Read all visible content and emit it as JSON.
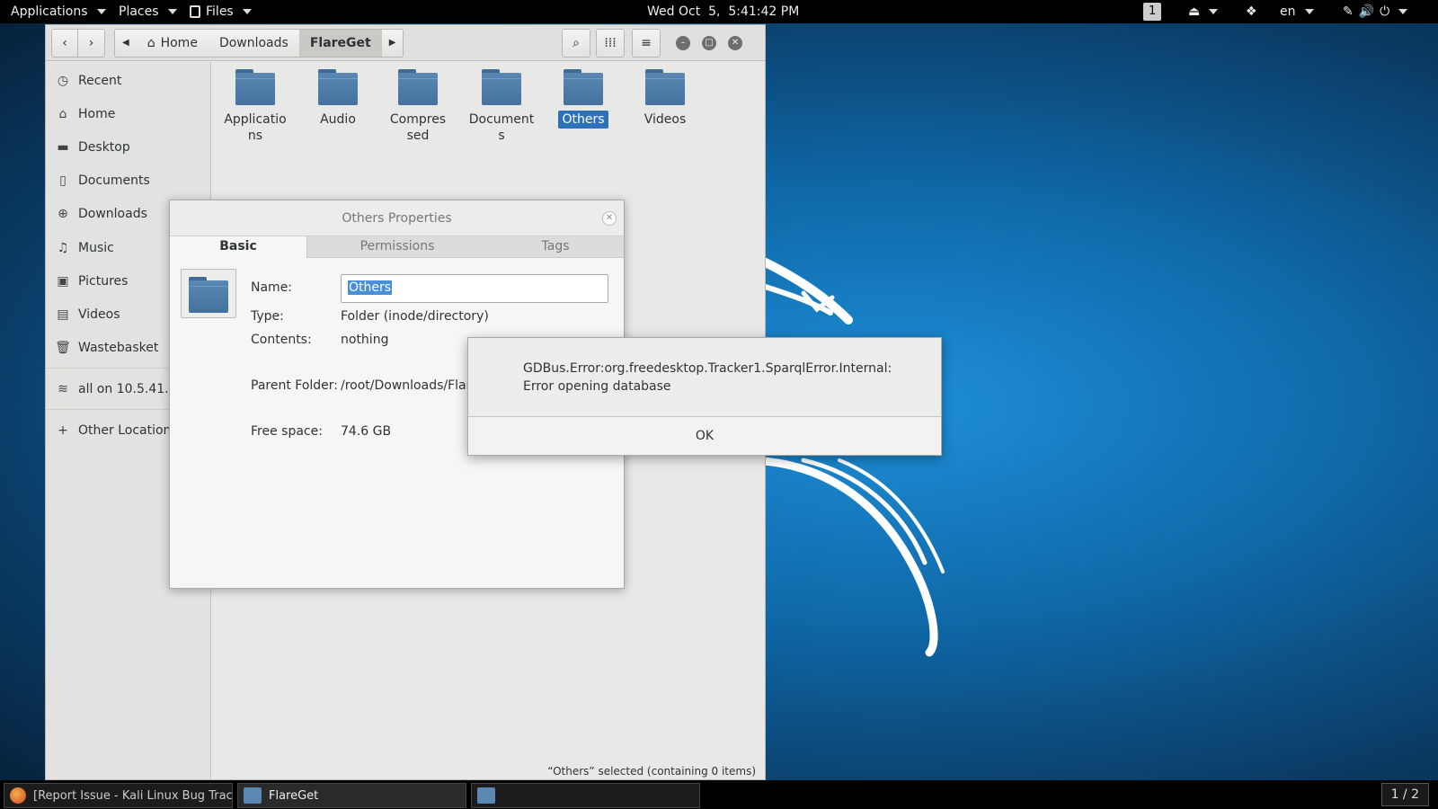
{
  "topbar": {
    "applications": "Applications",
    "places": "Places",
    "files": "Files",
    "clock": "Wed Oct  5,  5:41:42 PM",
    "workspace": "1",
    "language": "en"
  },
  "file_manager": {
    "breadcrumbs": [
      "Home",
      "Downloads",
      "FlareGet"
    ],
    "active_crumb": "FlareGet",
    "sidebar": {
      "items": [
        "Recent",
        "Home",
        "Desktop",
        "Documents",
        "Downloads",
        "Music",
        "Pictures",
        "Videos",
        "Wastebasket"
      ],
      "network": "all on 10.5.41....",
      "other_locations": "Other Locations"
    },
    "folders": [
      "Applications",
      "Audio",
      "Compressed",
      "Documents",
      "Others",
      "Videos"
    ],
    "selected_folder": "Others",
    "status": "“Others” selected  (containing 0 items)"
  },
  "properties": {
    "title": "Others Properties",
    "tabs": [
      "Basic",
      "Permissions",
      "Tags"
    ],
    "active_tab": "Basic",
    "labels": {
      "name": "Name:",
      "type": "Type:",
      "contents": "Contents:",
      "parent": "Parent Folder:",
      "free": "Free space:"
    },
    "values": {
      "name": "Others",
      "type": "Folder (inode/directory)",
      "contents": "nothing",
      "parent": "/root/Downloads/FlareGet",
      "free": "74.6 GB"
    }
  },
  "error_dialog": {
    "message": "GDBus.Error:org.freedesktop.Tracker1.SparqlError.Internal: Error opening database",
    "ok_label": "OK"
  },
  "taskbar": {
    "tasks": [
      "[Report Issue - Kali Linux Bug Trac...",
      "FlareGet",
      ""
    ],
    "pager": "1 / 2"
  },
  "colors": {
    "selection": "#2d72b8",
    "desktop_blue": "#1e8fd8",
    "topbar": "#000000"
  }
}
